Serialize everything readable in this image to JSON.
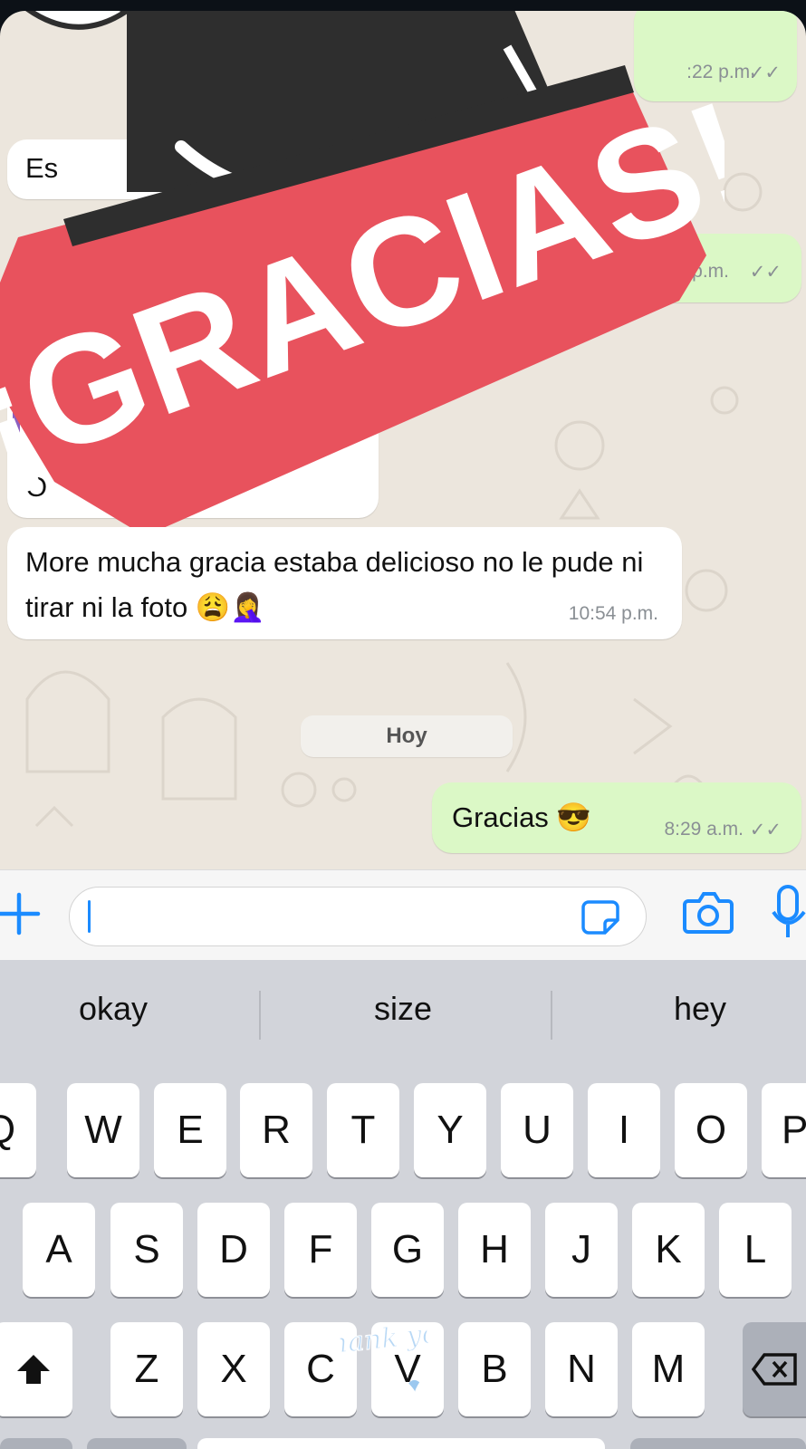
{
  "messages": [
    {
      "id": "m1",
      "dir": "out",
      "text": "",
      "time": ":22 p.m."
    },
    {
      "id": "m2",
      "dir": "in",
      "text": "Es",
      "time": ""
    },
    {
      "id": "m3",
      "dir": "out",
      "text": "",
      "time": "22 p.m."
    },
    {
      "id": "m4",
      "dir": "in",
      "text": "O",
      "time": ""
    },
    {
      "id": "m5",
      "dir": "in",
      "text": "More mucha gracia estaba delicioso no le pude ni tirar ni la foto 😩🤦‍♀️",
      "time": "10:54 p.m."
    },
    {
      "id": "m6",
      "dir": "out",
      "text": "Gracias 😎",
      "time": "8:29 a.m."
    }
  ],
  "day_separator": "Hoy",
  "overlay_sticker": {
    "text": "¡GRACIAS!",
    "icon": "gracias-sticker"
  },
  "keyboard_sticker": {
    "text": "Thank you",
    "icon": "thank-you-sticker"
  },
  "composer": {
    "value": "",
    "icons": [
      "plus-icon",
      "sticker-icon",
      "camera-icon",
      "microphone-icon"
    ]
  },
  "keyboard": {
    "suggestions": [
      "okay",
      "size",
      "hey"
    ],
    "row1": [
      "Q",
      "W",
      "E",
      "R",
      "T",
      "Y",
      "U",
      "I",
      "O",
      "P"
    ],
    "row2": [
      "A",
      "S",
      "D",
      "F",
      "G",
      "H",
      "J",
      "K",
      "L"
    ],
    "row3": [
      "Z",
      "X",
      "C",
      "V",
      "B",
      "N",
      "M"
    ]
  },
  "colors": {
    "outgoing": "#dbf8c6",
    "incoming": "#ffffff",
    "wallpaper": "#ece6dd",
    "accent": "#1b8bff",
    "sticker_red": "#e8525d"
  }
}
